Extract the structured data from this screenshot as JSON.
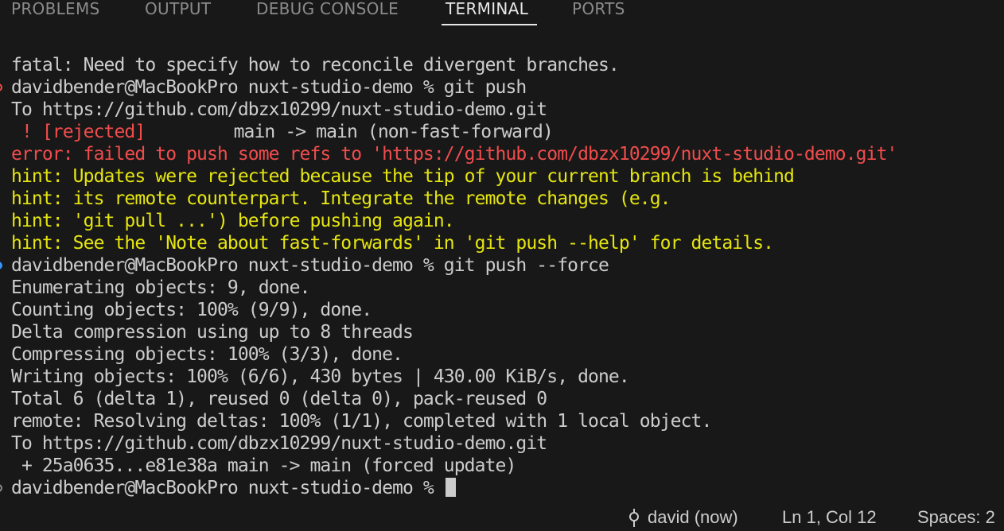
{
  "panel_tabs": [
    {
      "label": "PROBLEMS",
      "active": false
    },
    {
      "label": "OUTPUT",
      "active": false
    },
    {
      "label": "DEBUG CONSOLE",
      "active": false
    },
    {
      "label": "TERMINAL",
      "active": true
    },
    {
      "label": "PORTS",
      "active": false
    }
  ],
  "terminal": {
    "lines": [
      "fatal: Need to specify how to reconcile divergent branches.",
      "davidbender@MacBookPro nuxt-studio-demo % git push",
      "To https://github.com/dbzx10299/nuxt-studio-demo.git",
      " ! [rejected]",
      "        main -> main (non-fast-forward)",
      "error: failed to push some refs to 'https://github.com/dbzx10299/nuxt-studio-demo.git'",
      "hint: Updates were rejected because the tip of your current branch is behind",
      "hint: its remote counterpart. Integrate the remote changes (e.g.",
      "hint: 'git pull ...') before pushing again.",
      "hint: See the 'Note about fast-forwards' in 'git push --help' for details.",
      "davidbender@MacBookPro nuxt-studio-demo % git push --force",
      "Enumerating objects: 9, done.",
      "Counting objects: 100% (9/9), done.",
      "Delta compression using up to 8 threads",
      "Compressing objects: 100% (3/3), done.",
      "Writing objects: 100% (6/6), 430 bytes | 430.00 KiB/s, done.",
      "Total 6 (delta 1), reused 0 (delta 0), pack-reused 0",
      "remote: Resolving deltas: 100% (1/1), completed with 1 local object.",
      "To https://github.com/dbzx10299/nuxt-studio-demo.git",
      " + 25a0635...e81e38a main -> main (forced update)",
      "davidbender@MacBookPro nuxt-studio-demo % "
    ],
    "colors": {
      "default": "#cccccc",
      "error": "#f14c4c",
      "hint": "#e5e510",
      "success_decoration": "#3794ff"
    }
  },
  "statusbar": {
    "commit_icon": "git-commit-icon",
    "author": "david (now)",
    "cursor_position": "Ln 1, Col 12",
    "indentation": "Spaces: 2"
  }
}
